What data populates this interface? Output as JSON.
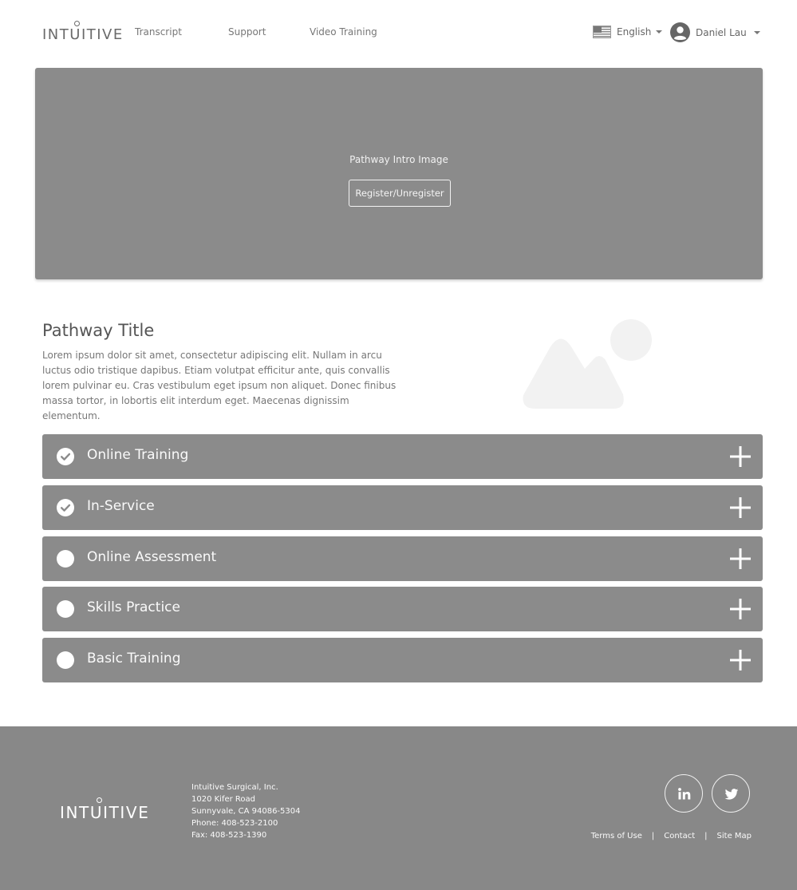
{
  "header": {
    "logo_text": "INTUITIVE",
    "nav": [
      "Transcript",
      "Support",
      "Video Training"
    ],
    "language": "English",
    "user_name": "Daniel Lau"
  },
  "hero": {
    "title": "Pathway Intro Image",
    "button_label": "Register/Unregister"
  },
  "intro": {
    "title": "Pathway Title",
    "description": "Lorem ipsum dolor sit amet, consectetur adipiscing elit. Nullam in arcu luctus odio tristique dapibus. Etiam volutpat efficitur ante, quis convallis lorem pulvinar eu. Cras vestibulum eget ipsum non aliquet. Donec finibus massa tortor, in lobortis elit interdum eget. Maecenas dignissim elementum."
  },
  "sections": [
    {
      "label": "Online Training",
      "completed": true
    },
    {
      "label": "In-Service",
      "completed": true
    },
    {
      "label": "Online Assessment",
      "completed": false
    },
    {
      "label": "Skills Practice",
      "completed": false
    },
    {
      "label": "Basic Training",
      "completed": false
    }
  ],
  "footer": {
    "logo_text": "INTUITIVE",
    "address": [
      "Intuitive Surgical, Inc.",
      "1020 Kifer Road",
      "Sunnyvale, CA 94086-5304",
      "Phone: 408-523-2100",
      "Fax: 408-523-1390"
    ],
    "links": [
      "Terms of Use",
      "Contact",
      "Site Map"
    ],
    "separator": "|",
    "social": [
      "linkedin-icon",
      "twitter-icon"
    ]
  },
  "colors": {
    "panel_gray": "#8b8b8b",
    "footer_gray": "#888888",
    "text_gray": "#555555"
  }
}
